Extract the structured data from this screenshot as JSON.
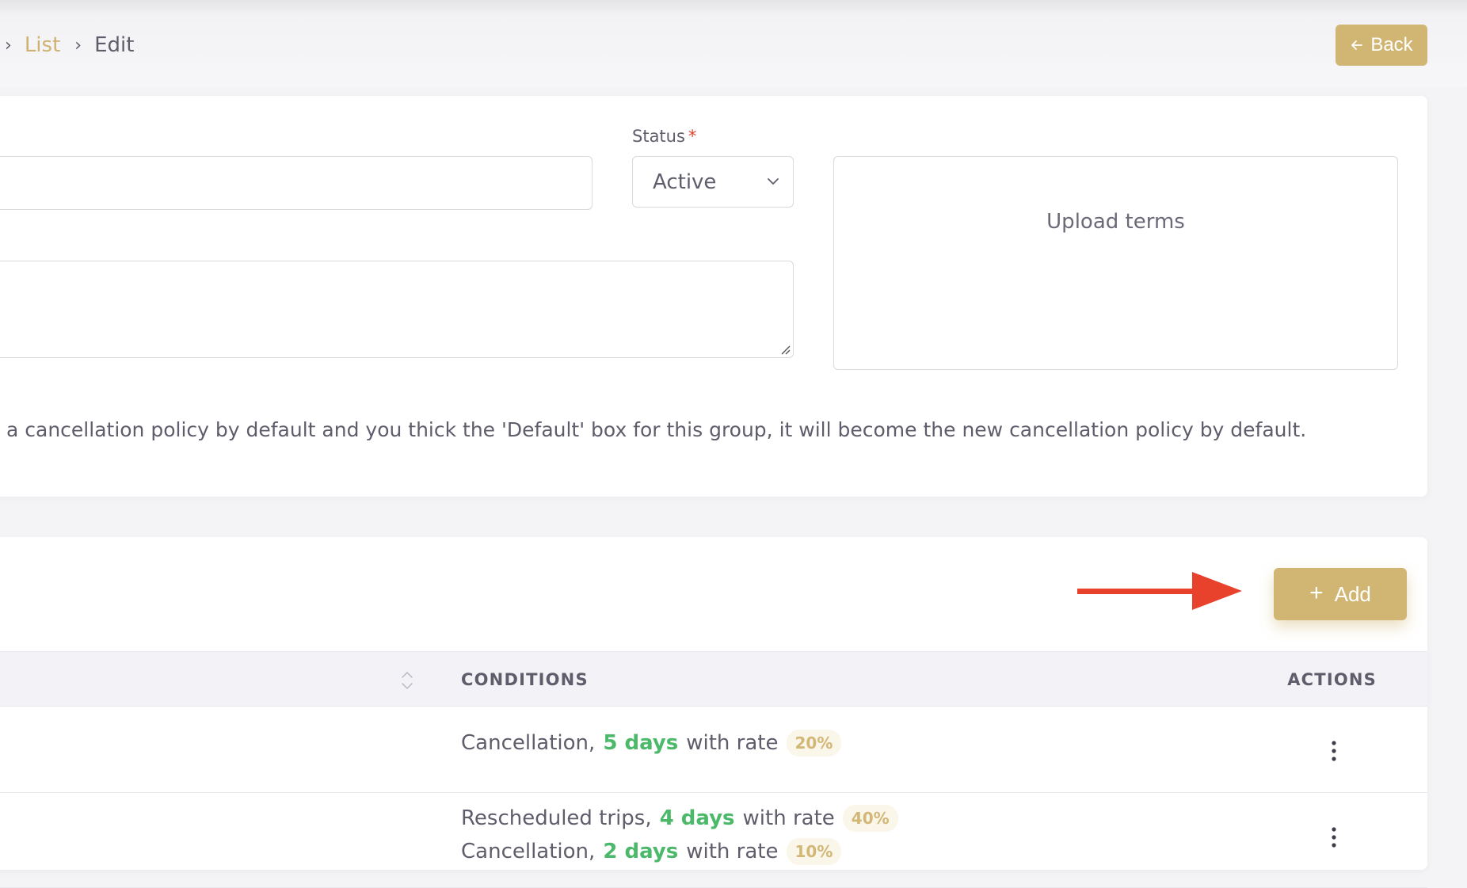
{
  "breadcrumb": {
    "link": "List",
    "current": "Edit"
  },
  "header": {
    "back_label": "Back"
  },
  "form": {
    "status_label": "Status",
    "status_required": "*",
    "status_value": "Active",
    "upload_label": "Upload terms",
    "note": "a cancellation policy by default and you thick the 'Default' box for this group, it will become the new cancellation policy by default."
  },
  "conditions_table": {
    "add_label": "Add",
    "columns": {
      "conditions": "CONDITIONS",
      "actions": "ACTIONS"
    },
    "rows": [
      {
        "lines": [
          {
            "type": "Cancellation,",
            "days": "5 days",
            "with": "with rate",
            "rate": "20%"
          }
        ]
      },
      {
        "lines": [
          {
            "type": "Rescheduled trips,",
            "days": "4 days",
            "with": "with rate",
            "rate": "40%"
          },
          {
            "type": "Cancellation,",
            "days": "2 days",
            "with": "with rate",
            "rate": "10%"
          }
        ]
      }
    ]
  },
  "colors": {
    "accent_gold": "#d1b673",
    "days_green": "#4cb96a",
    "required_red": "#e0422f",
    "annotation_arrow": "#e8412c"
  }
}
